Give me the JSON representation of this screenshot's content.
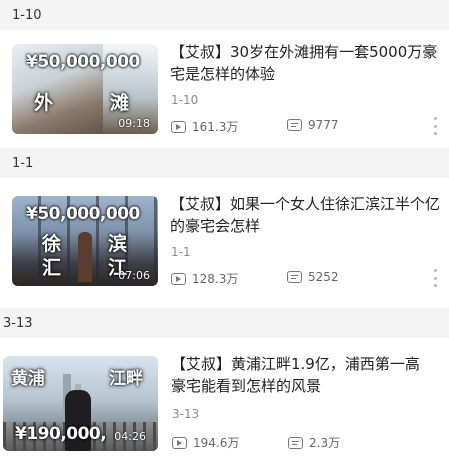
{
  "sections": [
    {
      "header": "1-10",
      "video": {
        "price": "¥50,000,000",
        "location_left": "外",
        "location_right": "滩",
        "duration": "09:18",
        "title": "【艾叔】30岁在外滩拥有一套5000万豪宅是怎样的体验",
        "date": "1-10",
        "views": "161.3万",
        "danmaku": "9777"
      }
    },
    {
      "header": "1-1",
      "video": {
        "price": "¥50,000,000",
        "location_left": "徐汇",
        "location_right": "滨江",
        "duration": "07:06",
        "title": "【艾叔】如果一个女人住徐汇滨江半个亿的豪宅会怎样",
        "date": "1-1",
        "views": "128.3万",
        "danmaku": "5252"
      }
    },
    {
      "header": "3-13",
      "video": {
        "price": "¥190,000,",
        "location_left": "黄浦",
        "location_right": "江畔",
        "duration": "04:26",
        "title": "【艾叔】黄浦江畔1.9亿，浦西第一高豪宅能看到怎样的风景",
        "date": "3-13",
        "views": "194.6万",
        "danmaku": "2.3万"
      }
    }
  ],
  "icons": {
    "views": "play-count-icon",
    "danmaku": "danmaku-count-icon",
    "more": "more-vertical-icon"
  },
  "colors": {
    "header_bg": "#f4f4f4",
    "meta_text": "#8a8a8a"
  }
}
